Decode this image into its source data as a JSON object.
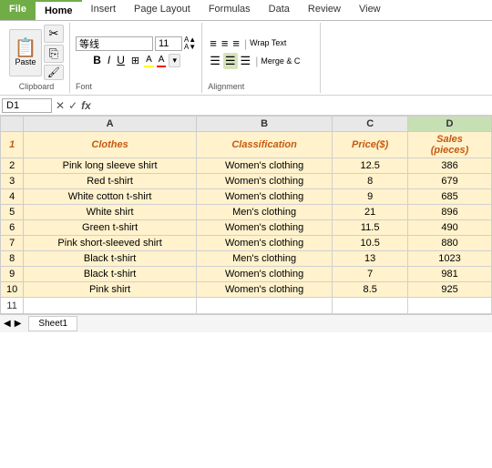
{
  "ribbon": {
    "tabs": [
      "File",
      "Home",
      "Insert",
      "Page Layout",
      "Formulas",
      "Data",
      "Review",
      "View"
    ],
    "active_tab": "Home",
    "clipboard_label": "Clipboard",
    "font_label": "Font",
    "alignment_label": "Alignment",
    "paste_label": "Paste",
    "font_name": "等线",
    "font_size": "11",
    "bold": "B",
    "italic": "I",
    "underline": "U",
    "wrap_text": "Wrap Text",
    "merge_cells": "Merge &amp; C"
  },
  "formula_bar": {
    "name_box": "D1",
    "formula_content": ""
  },
  "spreadsheet": {
    "col_headers": [
      "",
      "A",
      "B",
      "C",
      "D"
    ],
    "header_row": {
      "row_num": "1",
      "cols": [
        "Clothes",
        "Classification",
        "Price($)",
        "Sales\n(pieces)"
      ]
    },
    "rows": [
      {
        "row_num": "2",
        "cols": [
          "Pink long sleeve shirt",
          "Women's clothing",
          "12.5",
          "386"
        ]
      },
      {
        "row_num": "3",
        "cols": [
          "Red t-shirt",
          "Women's clothing",
          "8",
          "679"
        ]
      },
      {
        "row_num": "4",
        "cols": [
          "White cotton t-shirt",
          "Women's clothing",
          "9",
          "685"
        ]
      },
      {
        "row_num": "5",
        "cols": [
          "White shirt",
          "Men's clothing",
          "21",
          "896"
        ]
      },
      {
        "row_num": "6",
        "cols": [
          "Green t-shirt",
          "Women's clothing",
          "11.5",
          "490"
        ]
      },
      {
        "row_num": "7",
        "cols": [
          "Pink short-sleeved shirt",
          "Women's clothing",
          "10.5",
          "880"
        ]
      },
      {
        "row_num": "8",
        "cols": [
          "Black t-shirt",
          "Men's clothing",
          "13",
          "1023"
        ]
      },
      {
        "row_num": "9",
        "cols": [
          "Black t-shirt",
          "Women's clothing",
          "7",
          "981"
        ]
      },
      {
        "row_num": "10",
        "cols": [
          "Pink shirt",
          "Women's clothing",
          "8.5",
          "925"
        ]
      }
    ],
    "empty_row": {
      "row_num": "11"
    }
  },
  "sheet_tabs": [
    "Sheet1"
  ]
}
